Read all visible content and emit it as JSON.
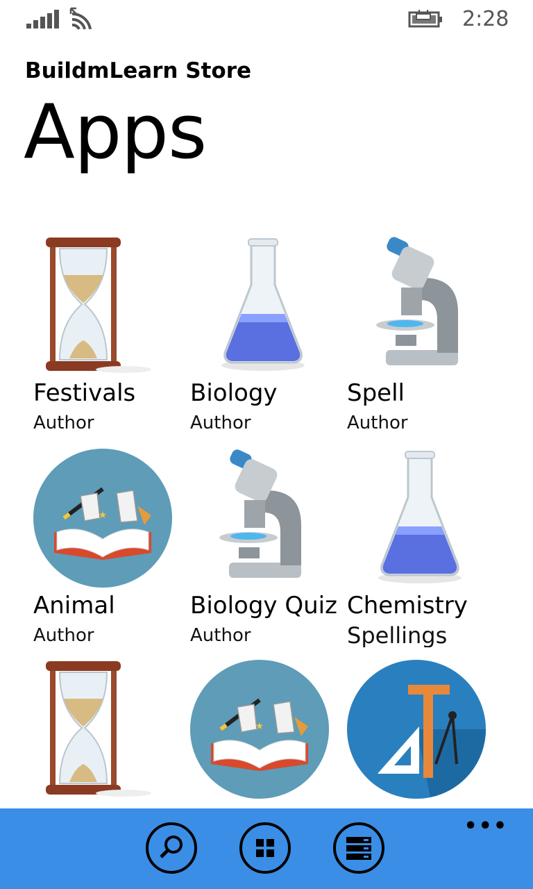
{
  "status": {
    "time": "2:28"
  },
  "header": {
    "app_title": "BuildmLearn Store",
    "page_title": "Apps"
  },
  "apps": [
    {
      "name": "Festivals",
      "author": "Author",
      "icon": "hourglass-icon"
    },
    {
      "name": "Biology",
      "author": "Author",
      "icon": "flask-icon"
    },
    {
      "name": "Spell",
      "author": "Author",
      "icon": "microscope-icon"
    },
    {
      "name": "Animal",
      "author": "Author",
      "icon": "magic-book-icon"
    },
    {
      "name": "Biology Quiz",
      "author": "Author",
      "icon": "microscope-icon"
    },
    {
      "name": "Chemistry",
      "author": "Spellings",
      "icon": "flask-icon"
    },
    {
      "name": "",
      "author": "",
      "icon": "hourglass-icon"
    },
    {
      "name": "",
      "author": "",
      "icon": "magic-book-icon"
    },
    {
      "name": "",
      "author": "",
      "icon": "geometry-tools-icon"
    }
  ],
  "app_bar": {
    "buttons": [
      "search-icon",
      "apps-grid-icon",
      "list-icon"
    ],
    "more": "•••",
    "color": "#3a8ee6"
  }
}
